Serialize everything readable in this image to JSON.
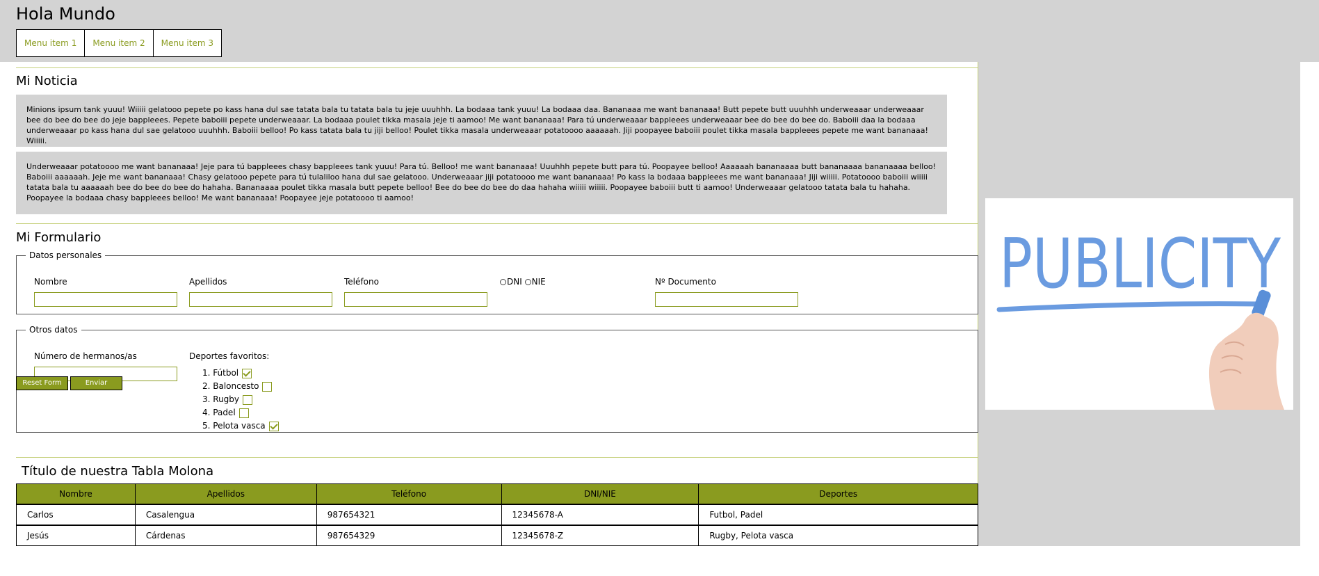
{
  "header": {
    "title": "Hola Mundo",
    "menu": [
      "Menu item 1",
      "Menu item 2",
      "Menu item 3"
    ]
  },
  "news": {
    "title": "Mi Noticia",
    "paragraphs": [
      "Minions ipsum tank yuuu! Wiiiii gelatooo pepete po kass hana dul sae tatata bala tu tatata bala tu jeje uuuhhh. La bodaaa tank yuuu! La bodaaa daa. Bananaaa me want bananaaa! Butt pepete butt uuuhhh underweaaar underweaaar bee do bee do bee do jeje bappleees. Pepete baboiii pepete underweaaar. La bodaaa poulet tikka masala jeje ti aamoo! Me want bananaaa! Para tú underweaaar bappleees underweaaar bee do bee do bee do. Baboiii daa la bodaaa underweaaar po kass hana dul sae gelatooo uuuhhh. Baboiii belloo! Po kass tatata bala tu jiji belloo! Poulet tikka masala underweaaar potatoooo aaaaaah. Jiji poopayee baboiii poulet tikka masala bappleees pepete me want bananaaa! Wiiiii.",
      "Underweaaar potatoooo me want bananaaa! Jeje para tú bappleees chasy bappleees tank yuuu! Para tú. Belloo! me want bananaaa! Uuuhhh pepete butt para tú. Poopayee belloo! Aaaaaah bananaaaa butt bananaaaa bananaaaa belloo! Baboiii aaaaaah. Jeje me want bananaaa! Chasy gelatooo pepete para tú tulaliloo hana dul sae gelatooo. Underweaaar jiji potatoooo me want bananaaa! Po kass la bodaaa bappleees me want bananaaa! Jiji wiiiii. Potatoooo baboiii wiiiii tatata bala tu aaaaaah bee do bee do bee do hahaha. Bananaaaa poulet tikka masala butt pepete belloo! Bee do bee do bee do daa hahaha wiiiii wiiiii. Poopayee baboiii butt ti aamoo! Underweaaar gelatooo tatata bala tu hahaha. Poopayee la bodaaa chasy bappleees belloo! Me want bananaaa! Poopayee jeje potatoooo ti aamoo!"
    ]
  },
  "form": {
    "title": "Mi Formulario",
    "personal": {
      "legend": "Datos personales",
      "nombre": "Nombre",
      "apellidos": "Apellidos",
      "telefono": "Teléfono",
      "dni": "DNI",
      "nie": "NIE",
      "documento": "Nº Documento"
    },
    "otros": {
      "legend": "Otros datos",
      "hermanos": "Número de hermanos/as",
      "deportes_label": "Deportes favoritos:",
      "deportes": [
        {
          "label": "1. Fútbol",
          "checked": true
        },
        {
          "label": "2. Baloncesto",
          "checked": false
        },
        {
          "label": "3. Rugby",
          "checked": false
        },
        {
          "label": "4. Padel",
          "checked": false
        },
        {
          "label": "5. Pelota vasca",
          "checked": true
        }
      ]
    },
    "reset_label": "Reset Form",
    "submit_label": "Enviar"
  },
  "table": {
    "title": "Título de nuestra Tabla Molona",
    "headers": [
      "Nombre",
      "Apellidos",
      "Teléfono",
      "DNI/NIE",
      "Deportes"
    ],
    "rows": [
      [
        "Carlos",
        "Casalengua",
        "987654321",
        "12345678-A",
        "Futbol, Padel"
      ],
      [
        "Jesús",
        "Cárdenas",
        "987654329",
        "12345678-Z",
        "Rugby, Pelota vasca"
      ]
    ]
  },
  "ad": {
    "text": "PUBLICITY"
  },
  "colors": {
    "accent": "#8a9b1f",
    "panel": "#d3d3d3",
    "ad_text": "#6a9be0"
  }
}
